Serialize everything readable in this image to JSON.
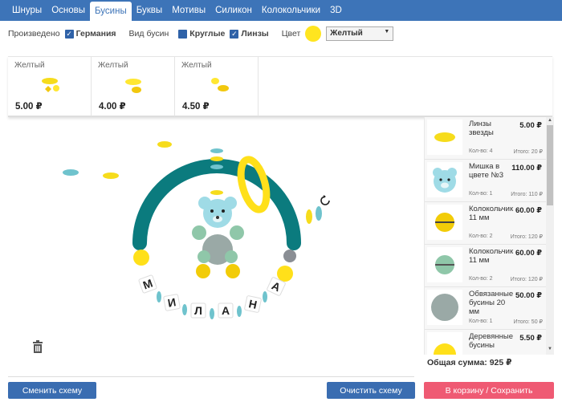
{
  "nav": {
    "tabs": [
      {
        "label": "Шнуры"
      },
      {
        "label": "Основы"
      },
      {
        "label": "Бусины"
      },
      {
        "label": "Буквы"
      },
      {
        "label": "Мотивы"
      },
      {
        "label": "Силикон"
      },
      {
        "label": "Колокольчики"
      },
      {
        "label": "3D"
      }
    ],
    "active": "Бусины"
  },
  "filters": {
    "production_label": "Произведено",
    "country": "Германия",
    "bead_type_label": "Вид бусин",
    "round": "Круглые",
    "lenses": "Линзы",
    "color_label": "Цвет",
    "color_value": "Желтый",
    "color_hex": "#ffe520"
  },
  "products": [
    {
      "name": "Желтый",
      "price": "5.00 ₽"
    },
    {
      "name": "Желтый",
      "price": "4.00 ₽"
    },
    {
      "name": "Желтый",
      "price": "4.50 ₽"
    }
  ],
  "canvas": {
    "letters": [
      "М",
      "И",
      "Л",
      "А",
      "Н",
      "А"
    ]
  },
  "cart": {
    "items": [
      {
        "name": "Линзы звезды",
        "price": "5.00 ₽",
        "qty": "Кол-во: 4",
        "total": "Итого: 20 ₽",
        "icon": "yellow-lens"
      },
      {
        "name": "Мишка в цвете №3",
        "price": "110.00 ₽",
        "qty": "Кол-во: 1",
        "total": "Итого: 110 ₽",
        "icon": "bear"
      },
      {
        "name": "Колокольчик 11 мм",
        "price": "60.00 ₽",
        "qty": "Кол-во: 2",
        "total": "Итого: 120 ₽",
        "icon": "yellow-bell"
      },
      {
        "name": "Колокольчик 11 мм",
        "price": "60.00 ₽",
        "qty": "Кол-во: 2",
        "total": "Итого: 120 ₽",
        "icon": "mint-bell"
      },
      {
        "name": "Обвязанные бусины 20 мм",
        "price": "50.00 ₽",
        "qty": "Кол-во: 1",
        "total": "Итого: 50 ₽",
        "icon": "knitted-bead"
      },
      {
        "name": "Деревянные бусины",
        "price": "5.50 ₽",
        "qty": "",
        "total": "",
        "icon": "yellow-bead"
      }
    ],
    "sum": "Общая сумма: 925 ₽"
  },
  "buttons": {
    "change_scheme": "Сменить схему",
    "clear_scheme": "Очистить схему",
    "to_cart": "В корзину / Сохранить"
  }
}
